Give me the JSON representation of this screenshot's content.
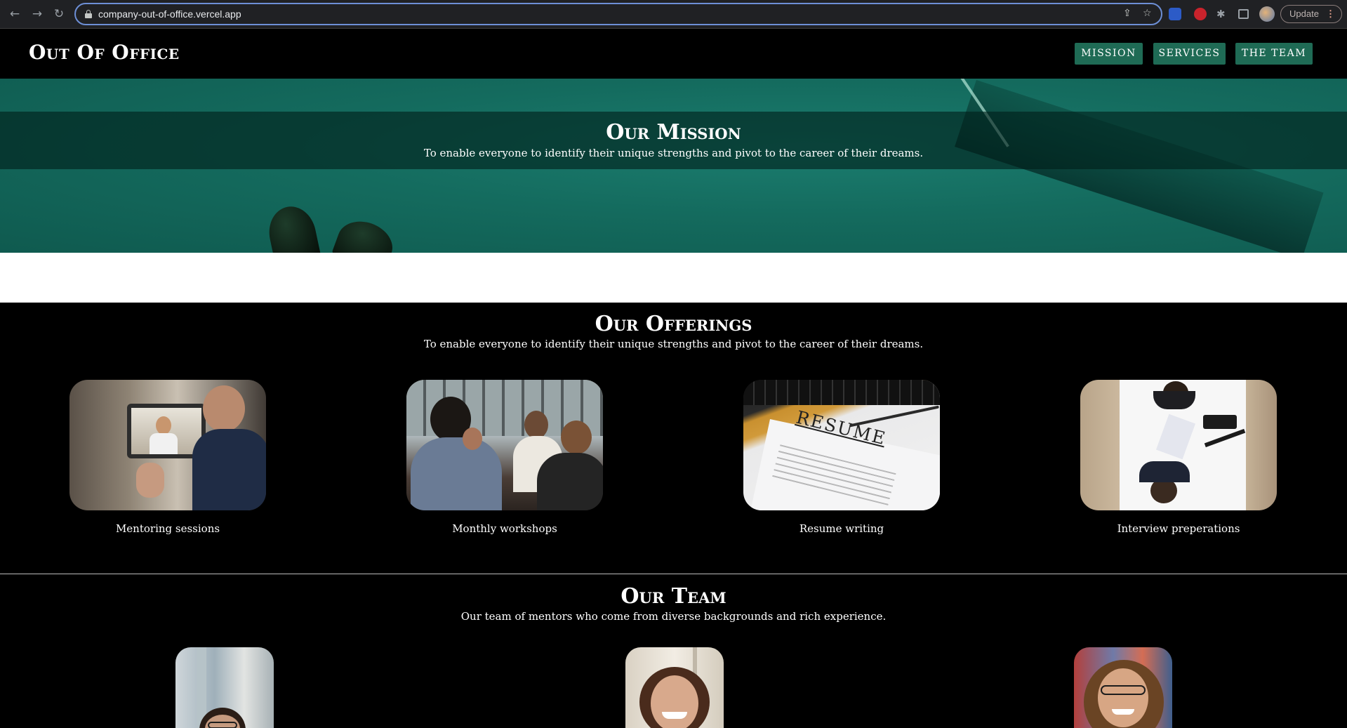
{
  "browser": {
    "url": "company-out-of-office.vercel.app",
    "update_label": "Update",
    "menu_glyph": "⋮"
  },
  "site": {
    "logo": "Out Of Office",
    "nav": [
      {
        "label": "MISSION"
      },
      {
        "label": "SERVICES"
      },
      {
        "label": "THE TEAM"
      }
    ],
    "accent_color": "#1f6b55"
  },
  "mission": {
    "title": "Our Mission",
    "subtitle": "To enable everyone to identify their unique strengths and pivot to the career of their dreams."
  },
  "offerings": {
    "title": "Our Offerings",
    "subtitle": "To enable everyone to identify their unique strengths and pivot to the career of their dreams.",
    "items": [
      {
        "label": "Mentoring sessions",
        "image": "video-call-mentoring-photo"
      },
      {
        "label": "Monthly workshops",
        "image": "group-meeting-photo"
      },
      {
        "label": "Resume writing",
        "image": "resume-document-photo"
      },
      {
        "label": "Interview preperations",
        "image": "interview-desk-photo"
      }
    ]
  },
  "team": {
    "title": "Our Team",
    "subtitle": "Our team of mentors who come from diverse backgrounds and rich experience.",
    "members": [
      {
        "image": "mentor-photo-1"
      },
      {
        "image": "mentor-photo-2"
      },
      {
        "image": "mentor-photo-3"
      }
    ]
  }
}
